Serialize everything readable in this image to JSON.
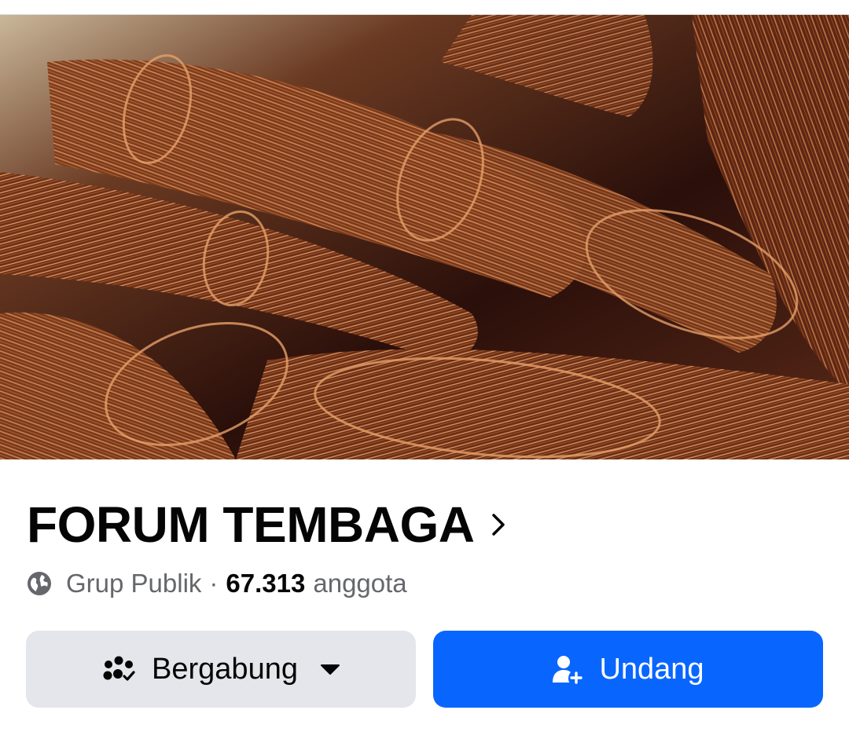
{
  "cover": {
    "description_icon": "copper-wire-cover-photo"
  },
  "group": {
    "name": "FORUM TEMBAGA",
    "privacy_label": "Grup Publik",
    "separator": "·",
    "member_count": "67.313",
    "member_label": "anggota"
  },
  "actions": {
    "join_label": "Bergabung",
    "invite_label": "Undang"
  },
  "colors": {
    "primary": "#0866ff",
    "secondary_button": "#e4e6eb",
    "text_primary": "#050505",
    "text_secondary": "#65676b"
  },
  "icons": {
    "privacy": "globe-icon",
    "title_chevron": "chevron-right-icon",
    "join": "group-check-icon",
    "join_caret": "caret-down-icon",
    "invite": "person-add-icon"
  }
}
